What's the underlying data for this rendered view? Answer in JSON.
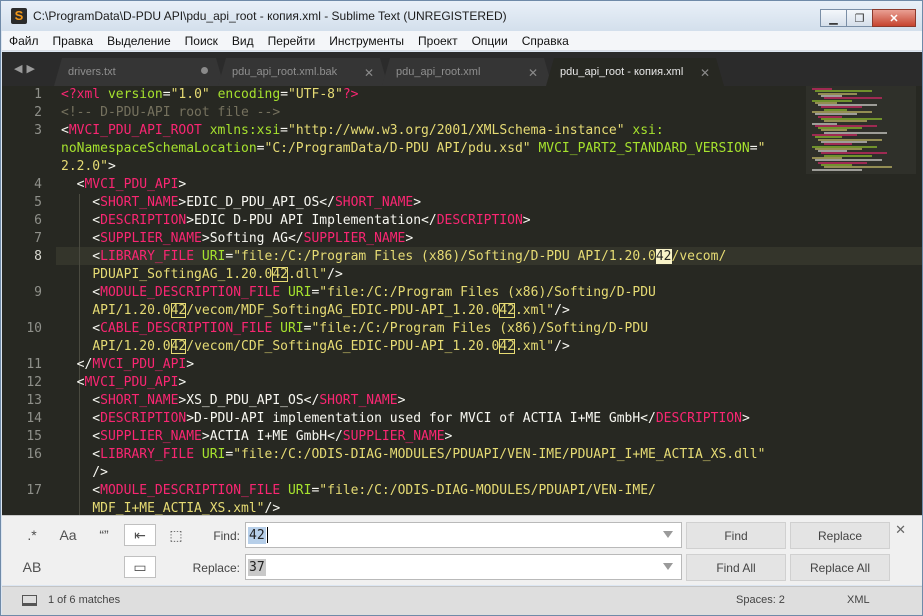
{
  "window": {
    "title": "C:\\ProgramData\\D-PDU API\\pdu_api_root - копия.xml - Sublime Text (UNREGISTERED)",
    "app_icon": "S",
    "minimize": "▁",
    "maximize": "❐",
    "close": "✕"
  },
  "menu": [
    "Файл",
    "Правка",
    "Выделение",
    "Поиск",
    "Вид",
    "Перейти",
    "Инструменты",
    "Проект",
    "Опции",
    "Справка"
  ],
  "tabs": {
    "nav": "◀▶",
    "items": [
      {
        "label": "drivers.txt",
        "state": "modified"
      },
      {
        "label": "pdu_api_root.xml.bak",
        "state": "close"
      },
      {
        "label": "pdu_api_root.xml",
        "state": "close"
      },
      {
        "label": "pdu_api_root - копия.xml",
        "state": "active"
      }
    ],
    "close_glyph": "✕"
  },
  "editor": {
    "line_numbers": [
      "1",
      "2",
      "3",
      "",
      "",
      "4",
      "5",
      "6",
      "7",
      "8",
      "",
      "9",
      "",
      "10",
      "",
      "11",
      "12",
      "13",
      "14",
      "15",
      "16",
      "",
      "17",
      ""
    ],
    "current_line": "8",
    "colors": {
      "background": "#272822",
      "tag": "#f92672",
      "attribute": "#a6e22e",
      "string": "#e6db74",
      "comment": "#75715e",
      "text": "#f8f8f2"
    }
  },
  "find_panel": {
    "toggles": {
      "regex": ".*",
      "case": "Aa",
      "word": "“”",
      "wrap": "⇤",
      "in_selection": "⬚",
      "preserve_case": "AB",
      "highlight": "▭"
    },
    "find_label": "Find:",
    "find_value": "42",
    "replace_label": "Replace:",
    "replace_value": "37",
    "find_button": "Find",
    "replace_button": "Replace",
    "find_all_button": "Find All",
    "replace_all_button": "Replace All",
    "close": "✕"
  },
  "status": {
    "matches": "1 of 6 matches",
    "spaces": "Spaces: 2",
    "syntax": "XML"
  }
}
